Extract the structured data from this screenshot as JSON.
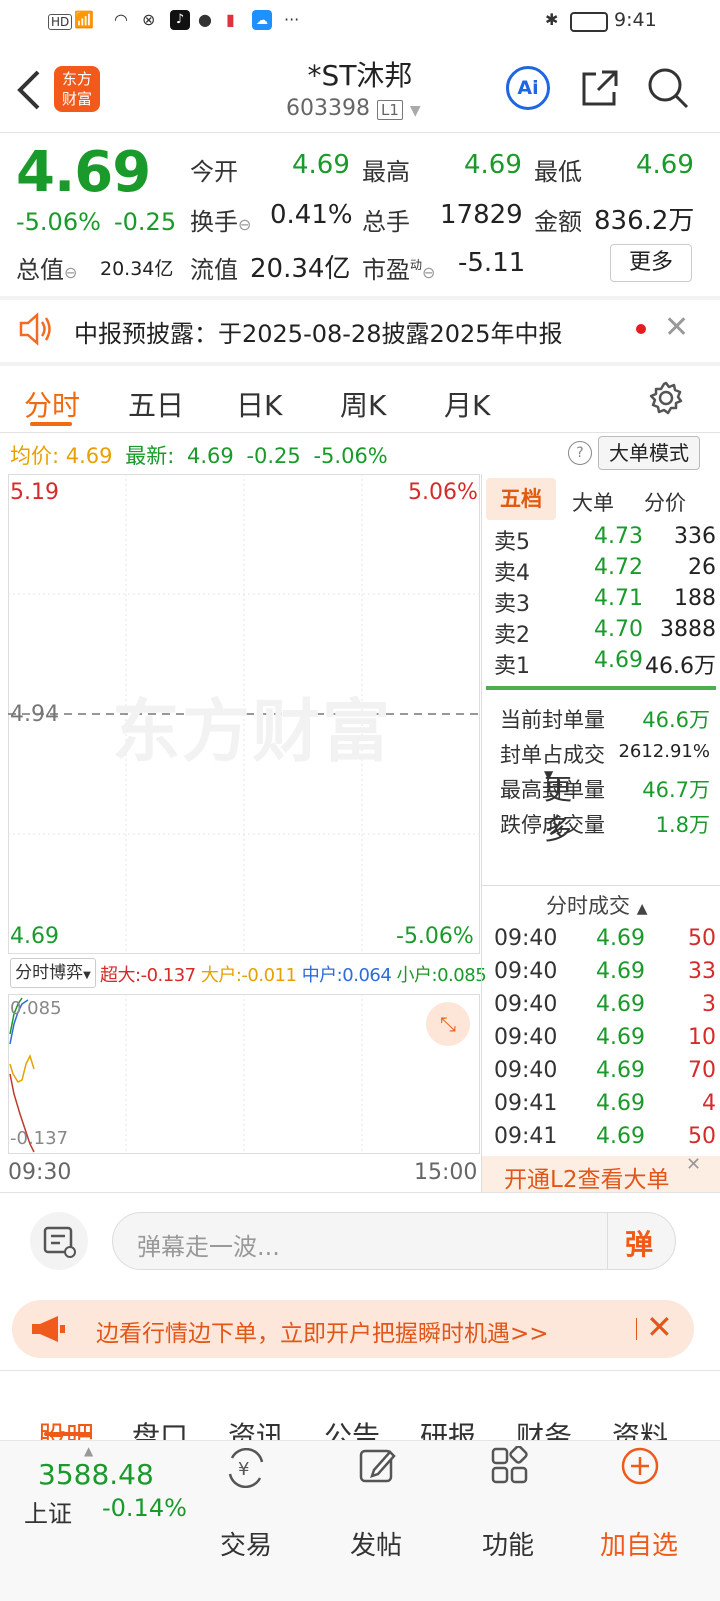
{
  "status": {
    "time": "9:41",
    "left_icons": [
      "hd-icon",
      "signal-icon",
      "wifi-icon",
      "app-icon",
      "tiktok-icon",
      "message-icon",
      "book-icon",
      "weather-icon"
    ],
    "more": "···"
  },
  "header": {
    "title": "*ST沐邦",
    "code": "603398",
    "level": "L1",
    "logo_text_1": "东方",
    "logo_text_2": "财富",
    "ai_label": "Ai"
  },
  "quote": {
    "price": "4.69",
    "change_pct": "-5.06%",
    "change": "-0.25",
    "open_label": "今开",
    "open": "4.69",
    "high_label": "最高",
    "high": "4.69",
    "low_label": "最低",
    "low": "4.69",
    "turnover_label": "换手",
    "turnover": "0.41%",
    "volume_label": "总手",
    "volume": "17829",
    "amount_label": "金额",
    "amount": "836.2万",
    "mktcap_label": "总值",
    "mktcap": "20.34亿",
    "float_label": "流值",
    "float": "20.34亿",
    "pe_label": "市盈",
    "pe_sup": "动",
    "pe": "-5.11",
    "more_button": "更多"
  },
  "notice": {
    "text": "中报预披露：于2025-08-28披露2025年中报"
  },
  "tabs": [
    "分时",
    "五日",
    "日K",
    "周K",
    "月K",
    "更多"
  ],
  "infobar": {
    "avg_label": "均价:",
    "avg": "4.69",
    "latest_label": "最新:",
    "latest": "4.69",
    "change": "-0.25",
    "pct": "-5.06%",
    "mode_button": "大单模式"
  },
  "chart": {
    "top_price": "5.19",
    "top_pct": "5.06%",
    "mid_price": "4.94",
    "bottom_price": "4.69",
    "bottom_pct": "-5.06%",
    "watermark": "东方财富",
    "time_start": "09:30",
    "time_end": "15:00"
  },
  "flow": {
    "selector": "分时博弈",
    "super_label": "超大:",
    "super": "-0.137",
    "large_label": "大户:",
    "large": "-0.011",
    "mid_label": "中户:",
    "mid": "0.064",
    "small_label": "小户:",
    "small": "0.085",
    "top_value": "0.085",
    "bottom_value": "-0.137"
  },
  "orderbook": {
    "tabs": [
      "五档",
      "大单",
      "分价"
    ],
    "rows": [
      {
        "label": "卖5",
        "price": "4.73",
        "vol": "336"
      },
      {
        "label": "卖4",
        "price": "4.72",
        "vol": "26"
      },
      {
        "label": "卖3",
        "price": "4.71",
        "vol": "188"
      },
      {
        "label": "卖2",
        "price": "4.70",
        "vol": "3888"
      },
      {
        "label": "卖1",
        "price": "4.69",
        "vol": "46.6万"
      }
    ],
    "seal": [
      {
        "label": "当前封单量",
        "value": "46.6万"
      },
      {
        "label": "封单占成交",
        "value": "2612.91%"
      },
      {
        "label": "最高封单量",
        "value": "46.7万"
      },
      {
        "label": "跌停成交量",
        "value": "1.8万"
      }
    ]
  },
  "ticks": {
    "title": "分时成交",
    "rows": [
      {
        "time": "09:40",
        "price": "4.69",
        "vol": "50"
      },
      {
        "time": "09:40",
        "price": "4.69",
        "vol": "33"
      },
      {
        "time": "09:40",
        "price": "4.69",
        "vol": "3"
      },
      {
        "time": "09:40",
        "price": "4.69",
        "vol": "10"
      },
      {
        "time": "09:40",
        "price": "4.69",
        "vol": "70"
      },
      {
        "time": "09:41",
        "price": "4.69",
        "vol": "4"
      },
      {
        "time": "09:41",
        "price": "4.69",
        "vol": "50"
      }
    ],
    "l2_banner": "开通L2查看大单"
  },
  "danmu": {
    "placeholder": "弹幕走一波...",
    "send": "弹"
  },
  "ad": {
    "text": "边看行情边下单，立即开户把握瞬时机遇>>"
  },
  "bottom_tabs": [
    "股吧",
    "盘口",
    "资讯",
    "公告",
    "研报",
    "财务",
    "资料"
  ],
  "bottom_nav": {
    "index_value": "3588.48",
    "index_name": "上证",
    "index_change": "-0.14%",
    "items": [
      "交易",
      "发帖",
      "功能",
      "加自选"
    ]
  }
}
